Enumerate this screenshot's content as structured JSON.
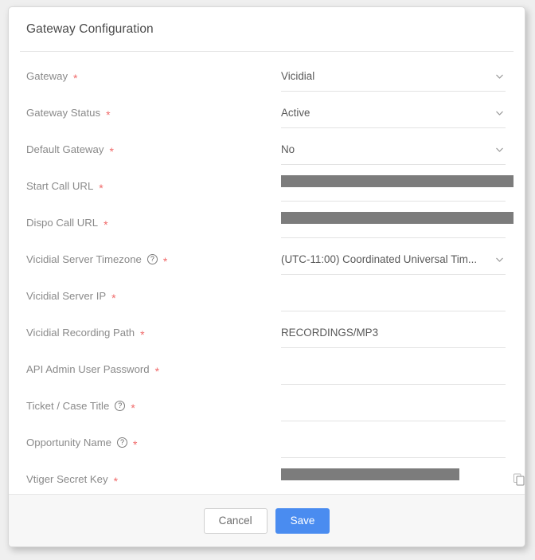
{
  "window": {
    "title": "Gateway Configuration"
  },
  "theme": {
    "save_button_color": "#4a8cf0",
    "required_star_color": "#f06a6a",
    "label_color": "#8a8a8a",
    "value_color": "#595959",
    "footer_background": "#f7f7f7",
    "redaction_color": "#7c7c7c"
  },
  "form": {
    "rows": [
      {
        "label": "Gateway",
        "required": true,
        "help": false,
        "type": "select",
        "value": "Vicidial",
        "redacted": false
      },
      {
        "label": "Gateway Status",
        "required": true,
        "help": false,
        "type": "select",
        "value": "Active",
        "redacted": false
      },
      {
        "label": "Default Gateway",
        "required": true,
        "help": false,
        "type": "select",
        "value": "No",
        "redacted": false
      },
      {
        "label": "Start Call URL",
        "required": true,
        "help": false,
        "type": "text",
        "value": "",
        "redacted": true,
        "redaction_width": 292
      },
      {
        "label": "Dispo Call URL",
        "required": true,
        "help": false,
        "type": "text",
        "value": "",
        "redacted": true,
        "redaction_width": 292
      },
      {
        "label": "Vicidial Server Timezone",
        "required": true,
        "help": true,
        "type": "select",
        "value": "(UTC-11:00) Coordinated Universal Tim...",
        "redacted": false
      },
      {
        "label": "Vicidial Server IP",
        "required": true,
        "help": false,
        "type": "text",
        "value": "",
        "redacted": false
      },
      {
        "label": "Vicidial Recording Path",
        "required": true,
        "help": false,
        "type": "text",
        "value": "RECORDINGS/MP3",
        "redacted": false
      },
      {
        "label": "API Admin User Password",
        "required": true,
        "help": false,
        "type": "password",
        "value": "",
        "redacted": false
      },
      {
        "label": "Ticket / Case Title",
        "required": true,
        "help": true,
        "type": "text",
        "value": "",
        "redacted": false
      },
      {
        "label": "Opportunity Name",
        "required": true,
        "help": true,
        "type": "text",
        "value": "",
        "redacted": false
      },
      {
        "label": "Vtiger Secret Key",
        "required": true,
        "help": false,
        "type": "text",
        "value": "",
        "redacted": true,
        "redaction_width": 224,
        "copy": true
      }
    ],
    "required_marker": "*",
    "help_glyph": "?"
  },
  "footer": {
    "cancel_label": "Cancel",
    "save_label": "Save"
  }
}
